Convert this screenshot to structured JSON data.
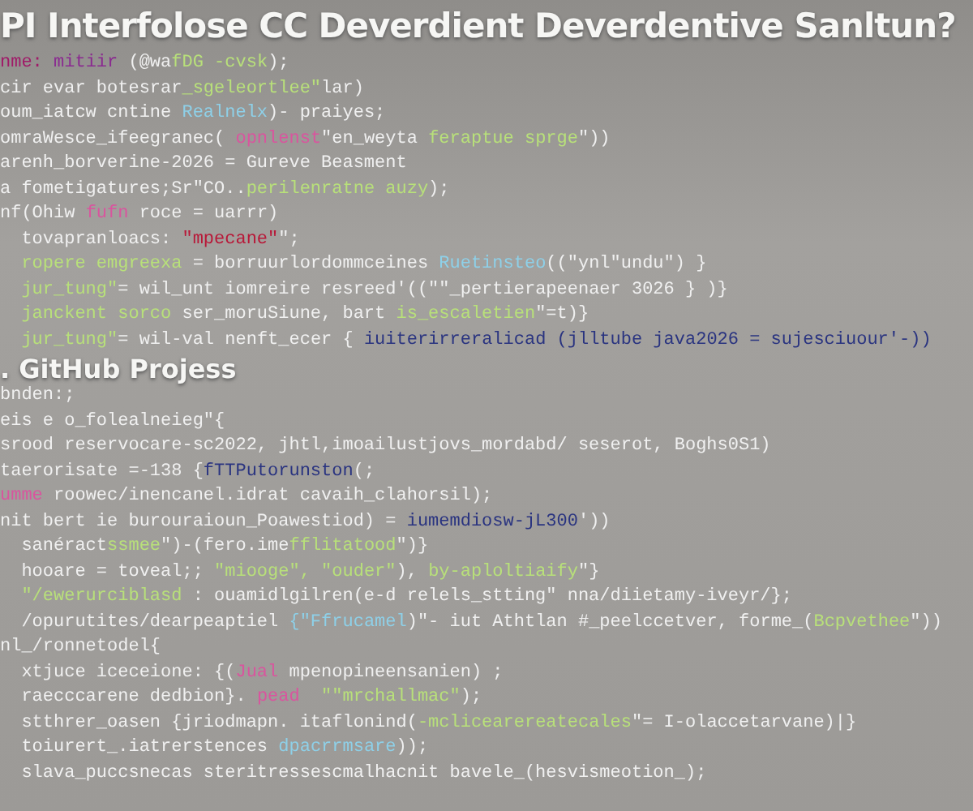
{
  "title": "PI Interfolose CC Deverdient Deverdentive Sanltun?",
  "sections": [
    {
      "lines": [
        [
          {
            "text": "nme: ",
            "color": "#a01a68"
          },
          {
            "text": "mitiir ",
            "color": "#8a2a90"
          },
          {
            "text": "(@wa",
            "color": "#f0f0f0"
          },
          {
            "text": "fDG -cvsk",
            "color": "#b8e07a"
          },
          {
            "text": ");",
            "color": "#f0f0f0"
          }
        ],
        [
          {
            "text": "cir evar botesrar",
            "color": "#f0f0f0"
          },
          {
            "text": "_sgeleortlee\"",
            "color": "#b8e07a"
          },
          {
            "text": "lar)",
            "color": "#f0f0f0"
          }
        ],
        [
          {
            "text": "oum_iatcw cntine ",
            "color": "#f0f0f0"
          },
          {
            "text": "Realnelx",
            "color": "#8ed0e8"
          },
          {
            "text": ")- praiyes;",
            "color": "#f0f0f0"
          }
        ],
        [
          {
            "text": "omraWesce_ifeegranec( ",
            "color": "#f0f0f0"
          },
          {
            "text": "opnlenst",
            "color": "#d9559e"
          },
          {
            "text": "\"en_weyta ",
            "color": "#f0f0f0"
          },
          {
            "text": "feraptue sprge",
            "color": "#b8e07a"
          },
          {
            "text": "\"))",
            "color": "#f0f0f0"
          }
        ],
        [
          {
            "text": "arenh_borverine-2026 = Gureve Beasment",
            "color": "#f0f0f0"
          }
        ],
        [
          {
            "text": "a fometigatures;Sr\"CO..",
            "color": "#f0f0f0"
          },
          {
            "text": "perilenratne auzy",
            "color": "#b8e07a"
          },
          {
            "text": ");",
            "color": "#f0f0f0"
          }
        ],
        [
          {
            "text": "nf(Ohiw ",
            "color": "#f0f0f0"
          },
          {
            "text": "fufn ",
            "color": "#d9559e"
          },
          {
            "text": "roce = uarrr)",
            "color": "#f0f0f0"
          }
        ],
        [
          {
            "text": "  tovapranloacs: ",
            "color": "#f0f0f0"
          },
          {
            "text": "\"mpecane\"",
            "color": "#b81838"
          },
          {
            "text": "\";",
            "color": "#f0f0f0"
          }
        ],
        [
          {
            "text": "  ropere emgreexa",
            "color": "#b8e07a"
          },
          {
            "text": " = borruurlordommceines ",
            "color": "#f0f0f0"
          },
          {
            "text": "Ruetinsteo",
            "color": "#8ed0e8"
          },
          {
            "text": "((\"ynl\"undu\") }",
            "color": "#f0f0f0"
          }
        ],
        [
          {
            "text": "  jur_tung\"",
            "color": "#b8e07a"
          },
          {
            "text": "= wil_unt iomreire resreed'((\"\"_pertierapeenaer 3026 } )}",
            "color": "#f0f0f0"
          }
        ],
        [
          {
            "text": "  janckent sorco ",
            "color": "#b8e07a"
          },
          {
            "text": "ser_moruSiune, bart ",
            "color": "#f0f0f0"
          },
          {
            "text": "is_escaletien",
            "color": "#b8e07a"
          },
          {
            "text": "\"=t)}",
            "color": "#f0f0f0"
          }
        ],
        [
          {
            "text": "  jur_tung\"",
            "color": "#b8e07a"
          },
          {
            "text": "= wil-val nenft_ecer { ",
            "color": "#f0f0f0"
          },
          {
            "text": "iuiterirreralicad (jlltube java2026 = sujesciuour'-))",
            "color": "#2a3480"
          }
        ]
      ]
    },
    {
      "heading": ". GitHub Projess",
      "lines": [
        [
          {
            "text": "bnden:;",
            "color": "#f0f0f0"
          }
        ],
        [
          {
            "text": "eis e o_folealneieg\"{",
            "color": "#f0f0f0"
          }
        ],
        [
          {
            "text": "srood reservocare-sc2022, jhtl,imoailustjovs_mordabd/ seserot, Boghs0S1)",
            "color": "#f0f0f0"
          }
        ],
        [
          {
            "text": "taerorisate =-138 {",
            "color": "#f0f0f0"
          },
          {
            "text": "fTTPutorunston",
            "color": "#2a3480"
          },
          {
            "text": "(;",
            "color": "#f0f0f0"
          }
        ],
        [
          {
            "text": "umme ",
            "color": "#d9559e"
          },
          {
            "text": "roowec/inencanel.idrat cavaih_clahorsil);",
            "color": "#f0f0f0"
          }
        ],
        [
          {
            "text": "nit bert ie burouraioun_Poawestiod) = ",
            "color": "#f0f0f0"
          },
          {
            "text": "iumemdiosw-jL300",
            "color": "#2a3480"
          },
          {
            "text": "'))",
            "color": "#f0f0f0"
          }
        ],
        [
          {
            "text": "  sanéract",
            "color": "#f0f0f0"
          },
          {
            "text": "ssmee",
            "color": "#b8e07a"
          },
          {
            "text": "\")-(fero.ime",
            "color": "#f0f0f0"
          },
          {
            "text": "fflitatood",
            "color": "#b8e07a"
          },
          {
            "text": "\")}",
            "color": "#f0f0f0"
          }
        ],
        [
          {
            "text": "  hooare = toveal;; ",
            "color": "#f0f0f0"
          },
          {
            "text": "\"miooge\", \"ouder\"",
            "color": "#b8e07a"
          },
          {
            "text": "), ",
            "color": "#f0f0f0"
          },
          {
            "text": "by-aploltiaify",
            "color": "#b8e07a"
          },
          {
            "text": "\"}",
            "color": "#f0f0f0"
          }
        ],
        [
          {
            "text": "  \"/ewerurciblasd",
            "color": "#b8e07a"
          },
          {
            "text": " : ouamidlgilren(e-d relels_stting\" nna/diietamy-iveyr/};",
            "color": "#f0f0f0"
          }
        ],
        [
          {
            "text": "  /opurutites/dearpeaptiel ",
            "color": "#f0f0f0"
          },
          {
            "text": "{\"Ffrucamel",
            "color": "#8ed0e8"
          },
          {
            "text": ")\"- iut Athtlan ",
            "color": "#f0f0f0"
          },
          {
            "text": "#_peelccetver",
            "color": "#f0f0f0"
          },
          {
            "text": ", forme_(",
            "color": "#f0f0f0"
          },
          {
            "text": "Bcpvethee",
            "color": "#b8e07a"
          },
          {
            "text": "\"))",
            "color": "#f0f0f0"
          }
        ],
        [
          {
            "text": "nl_/ronnetodel{",
            "color": "#f0f0f0"
          }
        ],
        [
          {
            "text": "  xtjuce iceceione: {(",
            "color": "#f0f0f0"
          },
          {
            "text": "Jual ",
            "color": "#d9559e"
          },
          {
            "text": "mpenopineensanien) ;",
            "color": "#f0f0f0"
          }
        ],
        [
          {
            "text": "  raecccarene dedbion}. ",
            "color": "#f0f0f0"
          },
          {
            "text": "pead  ",
            "color": "#d9559e"
          },
          {
            "text": "\"\"mrchallmac\"",
            "color": "#b8e07a"
          },
          {
            "text": ");",
            "color": "#f0f0f0"
          }
        ],
        [
          {
            "text": "  stthrer_oasen {jriodmapn. itaflonind(",
            "color": "#f0f0f0"
          },
          {
            "text": "-mclicearereatecales",
            "color": "#b8e07a"
          },
          {
            "text": "\"= I-olaccetarvane)|}",
            "color": "#f0f0f0"
          }
        ],
        [
          {
            "text": "  toiurert_.iatrerstences ",
            "color": "#f0f0f0"
          },
          {
            "text": "dpacrrmsare",
            "color": "#8ed0e8"
          },
          {
            "text": "));",
            "color": "#f0f0f0"
          }
        ],
        [
          {
            "text": "  slava_puccsnecas steritressescmalhacnit bavele_(hesvismeotion_);",
            "color": "#f0f0f0"
          }
        ]
      ]
    }
  ]
}
